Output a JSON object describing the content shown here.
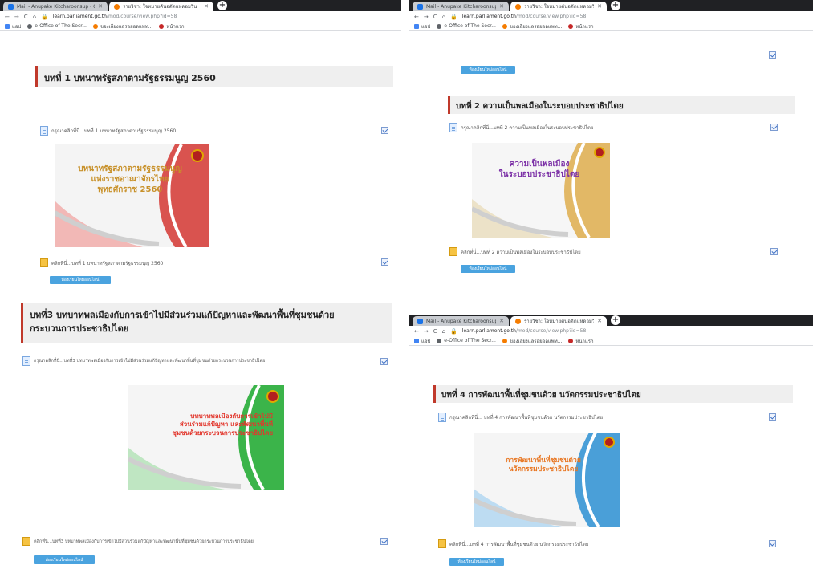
{
  "browser": {
    "tab1_title": "Mail - Anupake Kitcharoonsup - Outlook",
    "tab2_title": "รายวิชา: ใจหมายคันอดัตแหดอมวิน",
    "url_host": "learn.parliament.go.th",
    "url_path": "/mod/course/view.php?id=58",
    "bookmark_apps": "แอป",
    "bookmark_office": "e-Office of The Secr...",
    "bookmark_2": "ของเลียงแลรอยอลแพท...",
    "bookmark_3": "หน้าแรก"
  },
  "sections": {
    "s1": {
      "heading": "บทที่ 1 บทนาทรัฐสภาตามรัฐธรรมนูญ 2560",
      "intro": "กรุณาคลิกที่นี่...บทที่ 1 บทนาทรัฐสภาตามรัฐธรรมนูญ 2560",
      "slide_line1": "บทนาทรัฐสภาตามรัฐธรรมนูญ",
      "slide_line2": "แห่งราชอาณาจักรไทย",
      "slide_line3": "พุทธศักราช 2560",
      "file": "คลิกที่นี่...บทที่ 1 บทนาทรัฐสภาตามรัฐธรรมนูญ 2560",
      "button": "ห้องเรียนใหม่ออนไลน์"
    },
    "s2": {
      "heading": "บทที่ 2 ความเป็นพลเมืองในระบอบประชาธิปไตย",
      "intro": "กรุณาคลิกที่นี่...บทที่ 2 ความเป็นพลเมืองในระบอบประชาธิปไตย",
      "slide_line1": "ความเป็นพลเมือง",
      "slide_line2": "ในระบอบประชาธิปไตย",
      "file": "คลิกที่นี่...บทที่ 2 ความเป็นพลเมืองในระบอบประชาธิปไตย",
      "button": "ห้องเรียนใหม่ออนไลน์",
      "prev_button": "ห้องเรียนใหม่ออนไลน์"
    },
    "s3": {
      "heading_line1": "บทที่3 บทบาทพลเมืองกับการเข้าไปมีส่วนร่วมแก้ปัญหาและพัฒนาพื้นที่ชุมชนด้วย",
      "heading_line2": "กระบวนการประชาธิปไตย",
      "intro": "กรุณาคลิกที่นี่...บทที่3 บทบาทพลเมืองกับการเข้าไปมีส่วนร่วมแก้ปัญหาและพัฒนาพื้นที่ชุมชนด้วยกระบวนการประชาธิปไตย",
      "slide_line1": "บทบาทพลเมืองกับการเข้าไปมี",
      "slide_line2": "ส่วนร่วมแก้ปัญหา และพัฒนาพื้นที่",
      "slide_line3": "ชุมชนด้วยกระบวนการประชาธิปไตย",
      "file": "คลิกที่นี่...บทที่3 บทบาทพลเมืองกับการเข้าไปมีส่วนร่วมแก้ปัญหาและพัฒนาพื้นที่ชุมชนด้วยกระบวนการประชาธิปไตย",
      "button": "ห้องเรียนใหม่ออนไลน์"
    },
    "s4": {
      "heading": "บทที่ 4 การพัฒนาพื้นที่ชุมชนด้วย นวัตกรรมประชาธิปไตย",
      "intro": "กรุณาคลิกที่นี่... บทที่ 4 การพัฒนาพื้นที่ชุมชนด้วย นวัตกรรมประชาธิปไตย",
      "slide_line1": "การพัฒนาพื้นที่ชุมชนด้วย",
      "slide_line2": "นวัตกรรมประชาธิปไตย",
      "file": "คลิกที่นี่...บทที่ 4 การพัฒนาพื้นที่ชุมชนด้วย นวัตกรรมประชาธิปไตย",
      "button": "ห้องเรียนใหม่ออนไลน์"
    }
  },
  "colors": {
    "heading_accent": "#c0392b",
    "button_blue": "#4aa3df",
    "slide1_stripe": "#d9534f",
    "slide2_stripe": "#e2b866",
    "slide3_stripe": "#3bb44a",
    "slide4_stripe": "#4a9fd8"
  },
  "icons": [
    "back-arrow-icon",
    "forward-arrow-icon",
    "reload-icon",
    "home-icon",
    "lock-icon",
    "doc-icon",
    "package-icon",
    "checkbox-icon",
    "new-tab-icon",
    "close-tab-icon"
  ]
}
